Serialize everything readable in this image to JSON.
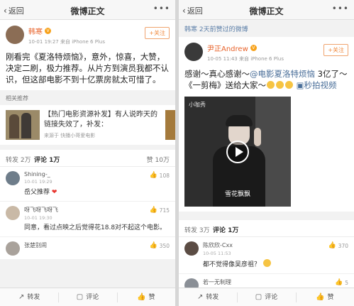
{
  "left": {
    "nav": {
      "back": "返回",
      "title": "微博正文",
      "more": "•••"
    },
    "post": {
      "author": "韩寒",
      "meta": "10-01 19:27  来自 iPhone 6 Plus",
      "follow": "+关注",
      "text": "刚看完《夏洛特烦恼》，意外，惊喜，大赞，决定二刷，极力推荐。从片方到演员我都不认识，但这部电影不到十亿票房就太可惜了。"
    },
    "related_label": "相关推荐",
    "rec": {
      "text": "【热门电影资源补发】有人说昨天的链接失效了，补发：",
      "source": "来源于 快播小哥爱电影"
    },
    "tabs": {
      "repost": "转发 2万",
      "comment": "评论 1万",
      "like": "赞 10万"
    },
    "comments": [
      {
        "name": "Shining-_",
        "time": "10-01 19:29",
        "text": "岳父推荐",
        "likes": "108",
        "heart": "❤"
      },
      {
        "name": "呀飞呀飞呀飞",
        "time": "10-01 19:30",
        "text": "同意，看过点映之后觉得花18.8对不起这个电影。",
        "likes": "715"
      },
      {
        "name": "张楚别闹",
        "likes": "350"
      }
    ],
    "bottom": {
      "repost": "转发",
      "comment": "评论",
      "like": "赞"
    }
  },
  "right": {
    "nav": {
      "back": "返回",
      "title": "微博正文",
      "more": "•••"
    },
    "repost_note": "韩寒 2天前赞过的微博",
    "post": {
      "author": "尹正Andrew",
      "meta": "10-05 11:43  来自 iPhone 6 Plus",
      "follow": "+关注",
      "text_a": "感谢～真心感谢～",
      "link1": "@电影夏洛特烦恼",
      "text_b": " 3亿了～《一剪梅》送给大家～",
      "link2": "秒拍视频",
      "video_brand": "小咖秀",
      "video_caption": "雪花飘飘"
    },
    "tabs": {
      "repost": "转发 3万",
      "comment": "评论 1万"
    },
    "comments": [
      {
        "name": "陈欣欣-Cxx",
        "time": "10-05 11:53",
        "text": "都不觉得像吴彦祖？",
        "likes": "370"
      },
      {
        "name": "若一无制理",
        "likes": "5"
      }
    ],
    "bottom": {
      "repost": "转发",
      "comment": "评论",
      "like": "赞"
    }
  },
  "colors": {
    "accent": "#f08a3e",
    "link": "#486d98",
    "name": "#e8632b"
  }
}
